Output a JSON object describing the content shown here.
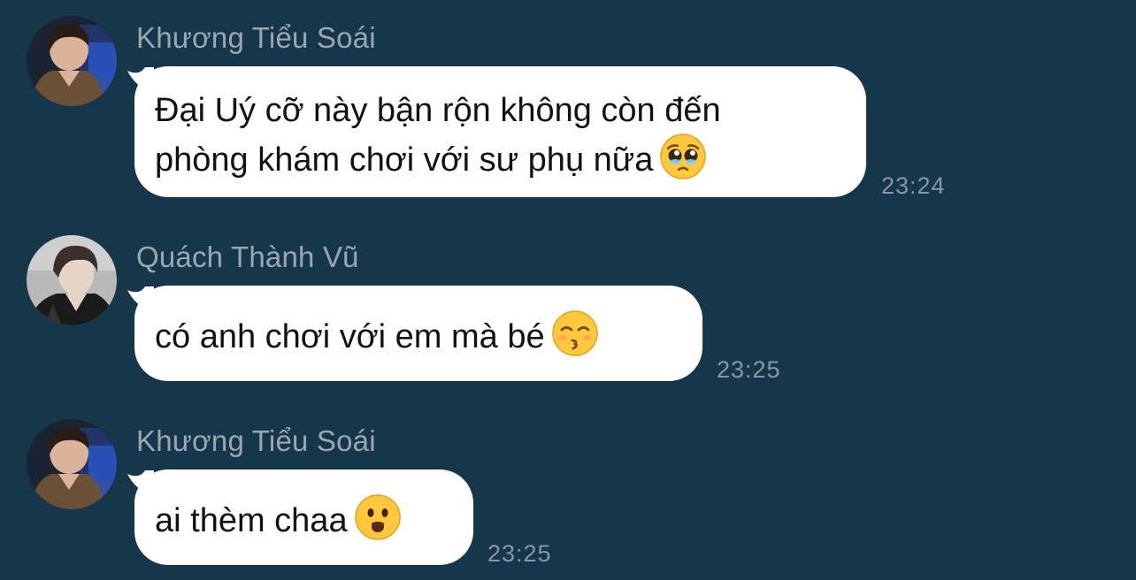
{
  "background_color": "#16364a",
  "messages": [
    {
      "sender": "Khương Tiểu Soái",
      "avatar_icon": "avatar-photo-khuong-tieu-soai",
      "lines": [
        "Đại Uý cỡ này bận rộn không còn đến",
        "phòng khám chơi với sư phụ nữa"
      ],
      "emoji": "pleading-face",
      "time": "23:24"
    },
    {
      "sender": "Quách Thành Vũ",
      "avatar_icon": "avatar-photo-quach-thanh-vu",
      "lines": [
        "có anh chơi với em mà bé"
      ],
      "emoji": "kissing-face-smiling-eyes",
      "time": "23:25"
    },
    {
      "sender": "Khương Tiểu Soái",
      "avatar_icon": "avatar-photo-khuong-tieu-soai",
      "lines": [
        "ai thèm chaa"
      ],
      "emoji": "frowning-face-open-mouth",
      "time": "23:25"
    }
  ]
}
